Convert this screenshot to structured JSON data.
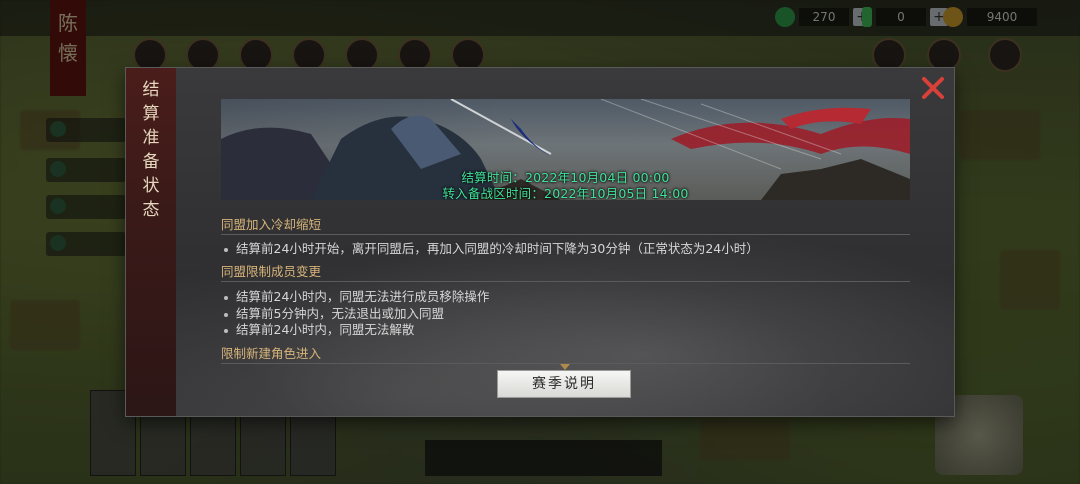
{
  "hud": {
    "player_name_char_1": "陈",
    "player_name_char_2": "懐",
    "resource_1_value": "270",
    "resource_2_value": "0",
    "resource_3_value": "9400",
    "plus_label": "+"
  },
  "dialog": {
    "title": "结算准备状态",
    "close_label": "✕",
    "banner": {
      "settle_time": "结算时间：2022年10月04日 00:00",
      "transfer_time": "转入备战区时间：2022年10月05日 14:00"
    },
    "sections": [
      {
        "title": "同盟加入冷却缩短",
        "items": [
          "结算前24小时开始，离开同盟后，再加入同盟的冷却时间下降为30分钟（正常状态为24小时）"
        ]
      },
      {
        "title": "同盟限制成员变更",
        "items": [
          "结算前24小时内，同盟无法进行成员移除操作",
          "结算前5分钟内，无法退出或加入同盟",
          "结算前24小时内，同盟无法解散"
        ]
      },
      {
        "title": "限制新建角色进入",
        "items": []
      }
    ],
    "season_button_label": "赛季说明"
  },
  "colors": {
    "accent_green": "#3fe29a",
    "section_gold": "#d7b47a",
    "close_red": "#d8403a",
    "title_strip": "#4a1d1a"
  }
}
